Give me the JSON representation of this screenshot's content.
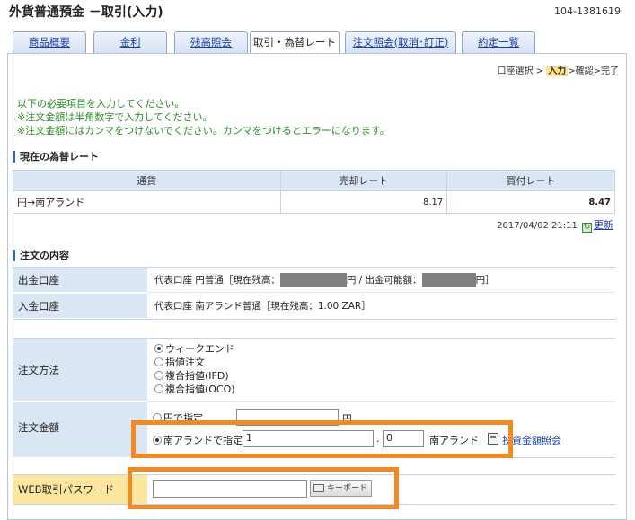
{
  "header": {
    "title": "外貨普通預金 －取引(入力)",
    "account_number": "104-1381619"
  },
  "tabs": [
    {
      "label": "商品概要",
      "active": false
    },
    {
      "label": "金利",
      "active": false
    },
    {
      "label": "残高照会",
      "active": false
    },
    {
      "label": "取引・為替レート",
      "active": true
    },
    {
      "label": "注文照会(取消･訂正)",
      "active": false
    },
    {
      "label": "約定一覧",
      "active": false
    }
  ],
  "steps": {
    "s1": "口座選択",
    "sep": ">",
    "s2": "入力",
    "s3": "確認",
    "s4": "完了"
  },
  "notes": [
    "以下の必要項目を入力してください。",
    "※注文金額は半角数字で入力してください。",
    "※注文金額にはカンマをつけないでください。カンマをつけるとエラーになります。"
  ],
  "rate_section": {
    "heading": "現在の為替レート",
    "headers": {
      "currency": "通貨",
      "sell": "売却レート",
      "buy": "買付レート"
    },
    "row": {
      "currency": "円→南アランド",
      "sell": "8.17",
      "buy": "8.47"
    },
    "timestamp": "2017/04/02 21:11",
    "refresh_label": "更新"
  },
  "order_section": {
    "heading": "注文の内容",
    "withdraw_label": "出金口座",
    "withdraw_prefix": "代表口座 円普通［現在残高：",
    "withdraw_mid": "円 / 出金可能額：",
    "withdraw_suffix": "円］",
    "deposit_label": "入金口座",
    "deposit_value": "代表口座 南アランド普通［現在残高：1.00 ZAR］",
    "method_label": "注文方法",
    "methods": [
      {
        "label": "ウィークエンド",
        "selected": true
      },
      {
        "label": "指値注文",
        "selected": false
      },
      {
        "label": "複合指値(IFD)",
        "selected": false
      },
      {
        "label": "複合指値(OCO)",
        "selected": false
      }
    ],
    "amount_label": "注文金額",
    "yen_option": "円で指定",
    "yen_unit": "円",
    "zar_option": "南アランドで指定",
    "zar_int": "1",
    "decimal_sep": ".",
    "zar_dec": "0",
    "zar_unit": "南アランド",
    "calc_link": "投資金額照会",
    "password_label": "WEB取引パスワード",
    "keyboard_label": "キーボード"
  }
}
